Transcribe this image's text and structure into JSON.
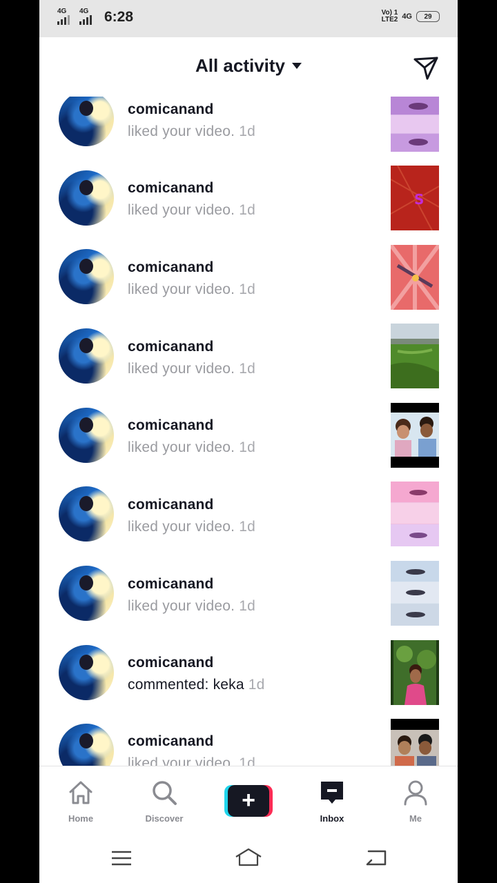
{
  "status_bar": {
    "signal1_label": "4G",
    "signal2_label": "4G",
    "time": "6:28",
    "volte_line1": "Vo) 1",
    "volte_line2": "LTE2",
    "network_right": "4G",
    "battery_level": "29"
  },
  "header": {
    "title": "All activity"
  },
  "notifications": [
    {
      "username": "comicanand",
      "activity": "liked your video.",
      "age": "1d",
      "thumb_style": "pink-faces"
    },
    {
      "username": "comicanand",
      "activity": "liked your video.",
      "age": "1d",
      "thumb_style": "red-texture"
    },
    {
      "username": "comicanand",
      "activity": "liked your video.",
      "age": "1d",
      "thumb_style": "red-burst"
    },
    {
      "username": "comicanand",
      "activity": "liked your video.",
      "age": "1d",
      "thumb_style": "landscape"
    },
    {
      "username": "comicanand",
      "activity": "liked your video.",
      "age": "1d",
      "thumb_style": "couple-selfie"
    },
    {
      "username": "comicanand",
      "activity": "liked your video.",
      "age": "1d",
      "thumb_style": "pink-faces"
    },
    {
      "username": "comicanand",
      "activity": "liked your video.",
      "age": "1d",
      "thumb_style": "face-strip"
    },
    {
      "username": "comicanand",
      "activity": "commented: keka",
      "age": "1d",
      "thumb_style": "girl-greenery"
    },
    {
      "username": "comicanand",
      "activity": "liked your video.",
      "age": "1d",
      "thumb_style": "couple-dark"
    }
  ],
  "bottom_nav": {
    "home": "Home",
    "discover": "Discover",
    "create": "+",
    "inbox": "Inbox",
    "me": "Me"
  },
  "colors": {
    "primary_text": "#161823",
    "secondary_text": "#9a9ba0",
    "create_cyan": "#20d5ec",
    "create_pink": "#fe2c55"
  }
}
